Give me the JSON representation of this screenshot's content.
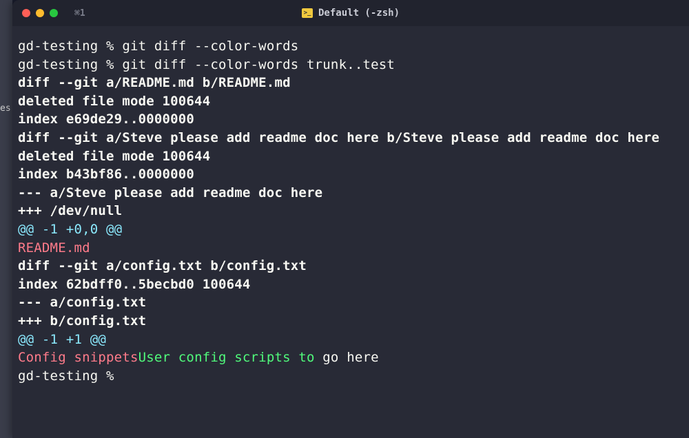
{
  "titlebar": {
    "tab_shortcut": "⌘1",
    "title": "Default (-zsh)",
    "icon_glyph": ">_"
  },
  "colors": {
    "bg": "#282a36",
    "fg": "#f8f8f2",
    "cyan": "#8be9fd",
    "red": "#ff7b8a",
    "green": "#50fa7b"
  },
  "terminal": {
    "lines": [
      {
        "segments": [
          {
            "cls": "prompt",
            "text": "gd-testing % "
          },
          {
            "cls": "cmd",
            "text": "git diff --color-words"
          }
        ]
      },
      {
        "segments": [
          {
            "cls": "prompt",
            "text": "gd-testing % "
          },
          {
            "cls": "cmd",
            "text": "git diff --color-words trunk..test"
          }
        ]
      },
      {
        "segments": [
          {
            "cls": "diff-header",
            "text": "diff --git a/README.md b/README.md"
          }
        ]
      },
      {
        "segments": [
          {
            "cls": "diff-meta",
            "text": "deleted file mode 100644"
          }
        ]
      },
      {
        "segments": [
          {
            "cls": "diff-meta",
            "text": "index e69de29..0000000"
          }
        ]
      },
      {
        "segments": [
          {
            "cls": "diff-header",
            "text": "diff --git a/Steve please add readme doc here b/Steve please add readme doc here"
          }
        ]
      },
      {
        "segments": [
          {
            "cls": "diff-meta",
            "text": "deleted file mode 100644"
          }
        ]
      },
      {
        "segments": [
          {
            "cls": "diff-meta",
            "text": "index b43bf86..0000000"
          }
        ]
      },
      {
        "segments": [
          {
            "cls": "diff-file",
            "text": "--- a/Steve please add readme doc here"
          }
        ]
      },
      {
        "segments": [
          {
            "cls": "diff-file",
            "text": "+++ /dev/null"
          }
        ]
      },
      {
        "segments": [
          {
            "cls": "hunk",
            "text": "@@ -1 +0,0 @@"
          }
        ]
      },
      {
        "segments": [
          {
            "cls": "removed",
            "text": "README.md"
          }
        ]
      },
      {
        "segments": [
          {
            "cls": "diff-header",
            "text": "diff --git a/config.txt b/config.txt"
          }
        ]
      },
      {
        "segments": [
          {
            "cls": "diff-meta",
            "text": "index 62bdff0..5becbd0 100644"
          }
        ]
      },
      {
        "segments": [
          {
            "cls": "diff-file",
            "text": "--- a/config.txt"
          }
        ]
      },
      {
        "segments": [
          {
            "cls": "diff-file",
            "text": "+++ b/config.txt"
          }
        ]
      },
      {
        "segments": [
          {
            "cls": "hunk",
            "text": "@@ -1 +1 @@"
          }
        ]
      },
      {
        "segments": [
          {
            "cls": "removed",
            "text": "Config snippets"
          },
          {
            "cls": "added",
            "text": "User config scripts to"
          },
          {
            "cls": "normal",
            "text": " go here"
          }
        ]
      },
      {
        "segments": [
          {
            "cls": "prompt",
            "text": "gd-testing % "
          }
        ]
      }
    ]
  },
  "sliver_text": "es"
}
